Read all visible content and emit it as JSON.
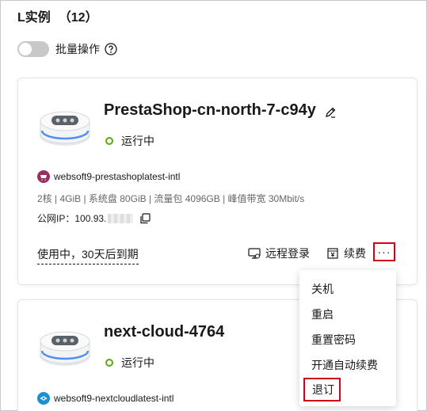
{
  "header": {
    "title": "L实例",
    "count": "（12）"
  },
  "batch": {
    "label": "批量操作"
  },
  "instances": [
    {
      "name": "PrestaShop-cn-north-7-c94y",
      "status": "运行中",
      "image": "websoft9-prestashoplatest-intl",
      "specs": "2核 | 4GiB | 系统盘 80GiB | 流量包 4096GB | 峰值带宽 30Mbit/s",
      "ip_label": "公网IP：",
      "ip_value": "100.93.",
      "expire": "使用中，30天后到期",
      "actions": {
        "remote": "远程登录",
        "renew": "续费",
        "more": "···"
      }
    },
    {
      "name": "next-cloud-4764",
      "status": "运行中",
      "image": "websoft9-nextcloudlatest-intl"
    }
  ],
  "dropdown": {
    "items": [
      "关机",
      "重启",
      "重置密码",
      "开通自动续费",
      "退订"
    ]
  },
  "colors": {
    "status_green": "#5aa80e",
    "highlight_red": "#d0021b",
    "prestashop_icon": "#9b2d5f",
    "nextcloud_icon": "#1a8fd6"
  }
}
